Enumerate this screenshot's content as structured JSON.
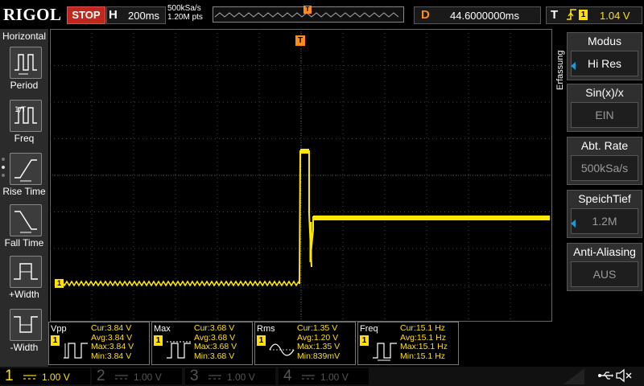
{
  "topbar": {
    "logo": "RIGOL",
    "run_state": "STOP",
    "timebase_label": "H",
    "timebase_value": "200ms",
    "sample_rate": "500kSa/s",
    "memory_points": "1.20M pts",
    "trigger_marker": "T",
    "delay_label": "D",
    "delay_value": "44.6000000ms",
    "trigger_label": "T",
    "trigger_edge_icon": "rising-edge-icon",
    "trigger_channel": "1",
    "trigger_level": "1.04 V"
  },
  "left_panel": {
    "title": "Horizontal",
    "items": [
      {
        "label": "Period",
        "icon": "period-icon"
      },
      {
        "label": "Freq",
        "icon": "freq-icon"
      },
      {
        "label": "Rise Time",
        "icon": "rise-time-icon"
      },
      {
        "label": "Fall Time",
        "icon": "fall-time-icon"
      },
      {
        "label": "+Width",
        "icon": "positive-width-icon"
      },
      {
        "label": "-Width",
        "icon": "negative-width-icon"
      }
    ]
  },
  "right_panel": {
    "tab_label": "Erfassung",
    "items": [
      {
        "title": "Modus",
        "value": "Hi Res"
      },
      {
        "title": "Sin(x)/x",
        "value": "EIN"
      },
      {
        "title": "Abt. Rate",
        "value": "500kSa/s"
      },
      {
        "title": "SpeichTief",
        "value": "1.2M"
      },
      {
        "title": "Anti-Aliasing",
        "value": "AUS"
      }
    ]
  },
  "waveform": {
    "channel_marker": "1",
    "trigger_top_marker": "T",
    "trigger_level_marker": "T",
    "color": "#ffe800"
  },
  "measurements": [
    {
      "name": "Vpp",
      "channel": "1",
      "cur": "Cur:3.84 V",
      "avg": "Avg:3.84 V",
      "max": "Max:3.84 V",
      "min": "Min:3.84 V"
    },
    {
      "name": "Max",
      "channel": "1",
      "cur": "Cur:3.68 V",
      "avg": "Avg:3.68 V",
      "max": "Max:3.68 V",
      "min": "Min:3.68 V"
    },
    {
      "name": "Rms",
      "channel": "1",
      "cur": "Cur:1.35 V",
      "avg": "Avg:1.20 V",
      "max": "Max:1.35 V",
      "min": "Min:839mV"
    },
    {
      "name": "Freq",
      "channel": "1",
      "cur": "Cur:15.1 Hz",
      "avg": "Avg:15.1 Hz",
      "max": "Max:15.1 Hz",
      "min": "Min:15.1 Hz"
    }
  ],
  "channels": [
    {
      "number": "1",
      "scale": "1.00 V",
      "color": "#ffe000",
      "active": true
    },
    {
      "number": "2",
      "scale": "1.00 V",
      "color": "#00c0ff",
      "active": false
    },
    {
      "number": "3",
      "scale": "1.00 V",
      "color": "#ff40ff",
      "active": false
    },
    {
      "number": "4",
      "scale": "1.00 V",
      "color": "#3070ff",
      "active": false
    }
  ],
  "status_icons": [
    "usb-icon",
    "speaker-muted-icon"
  ]
}
